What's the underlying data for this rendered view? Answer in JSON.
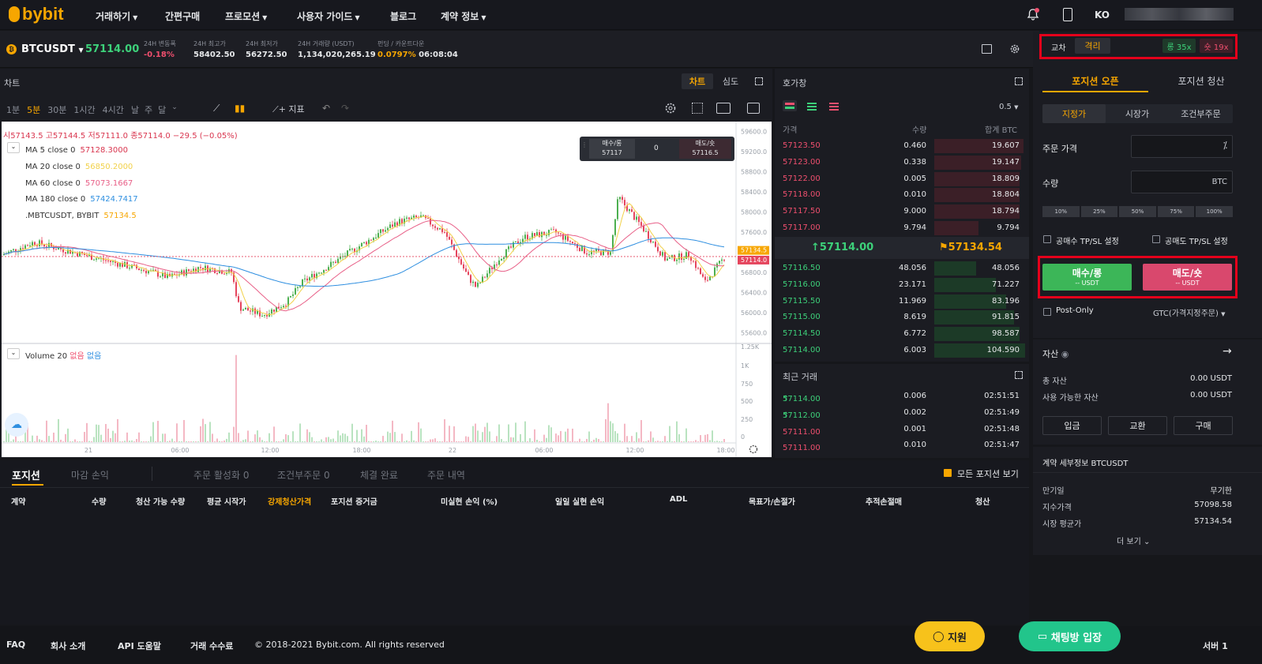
{
  "nav": {
    "logo": "bybit",
    "items": [
      "거래하기",
      "간편구매",
      "프로모션",
      "사용자 가이드",
      "블로그",
      "계약 정보"
    ],
    "lang": "KO"
  },
  "ticker": {
    "symbol": "BTCUSDT",
    "last": "57114.00",
    "labels": [
      "24H 변동폭",
      "24H 최고가",
      "24H 최저가",
      "24H 거래량 (USDT)",
      "펀딩 / 카운트다운"
    ],
    "values": [
      "-0.18%",
      "58402.50",
      "56272.50",
      "1,134,020,265.19",
      "0.0797%",
      "06:08:04"
    ]
  },
  "chart": {
    "title": "차트",
    "tab_chart": "차트",
    "tab_depth": "심도",
    "intervals": [
      "1분",
      "5분",
      "30분",
      "1시간",
      "4시간",
      "날",
      "주",
      "달"
    ],
    "indicator_label": "지표",
    "ohlc": "시57143.5 고57144.5 저57111.0 종57114.0 −29.5 (−0.05%)",
    "ma": [
      {
        "label": "MA 5 close 0",
        "value": "57128.3000",
        "color": "#d9364f"
      },
      {
        "label": "MA 20 close 0",
        "value": "56850.2000",
        "color": "#f2d149"
      },
      {
        "label": "MA 60 close 0",
        "value": "57073.1667",
        "color": "#e85f87"
      },
      {
        "label": "MA 180 close 0",
        "value": "57424.7417",
        "color": "#2f8fe0"
      },
      {
        "label": ".MBTCUSDT, BYBIT",
        "value": "57134.5",
        "color": "#f7a600"
      }
    ],
    "trade_widget": {
      "buy": "매수/롱",
      "buy_price": "57117",
      "qty": "0",
      "sell": "매도/숏",
      "sell_price": "57116.5"
    },
    "price_ticks": [
      "59600.0",
      "59200.0",
      "58800.0",
      "58400.0",
      "58000.0",
      "57600.0",
      "57200.0",
      "56800.0",
      "56400.0",
      "56000.0",
      "55600.0"
    ],
    "last_badge": "57134.5",
    "last_badge2": "57114.0",
    "volume_label": "Volume 20",
    "vol_na1": "없음",
    "vol_na2": "없음",
    "vol_ticks": [
      "1.25K",
      "1K",
      "750",
      "500",
      "250",
      "0"
    ],
    "time_ticks": [
      "21",
      "06:00",
      "12:00",
      "18:00",
      "22",
      "06:00",
      "12:00",
      "18:00"
    ]
  },
  "orderbook": {
    "title": "호가창",
    "precision": "0.5",
    "cols": [
      "가격",
      "수량",
      "합계 BTC"
    ],
    "asks": [
      [
        "57123.50",
        "0.460",
        "19.607"
      ],
      [
        "57123.00",
        "0.338",
        "19.147"
      ],
      [
        "57122.00",
        "0.005",
        "18.809"
      ],
      [
        "57118.00",
        "0.010",
        "18.804"
      ],
      [
        "57117.50",
        "9.000",
        "18.794"
      ],
      [
        "57117.00",
        "9.794",
        "9.794"
      ]
    ],
    "mid_last": "57114.00",
    "mid_mark": "57134.54",
    "bids": [
      [
        "57116.50",
        "48.056",
        "48.056"
      ],
      [
        "57116.00",
        "23.171",
        "71.227"
      ],
      [
        "57115.50",
        "11.969",
        "83.196"
      ],
      [
        "57115.00",
        "8.619",
        "91.815"
      ],
      [
        "57114.50",
        "6.772",
        "98.587"
      ],
      [
        "57114.00",
        "6.003",
        "104.590"
      ]
    ]
  },
  "trades": {
    "title": "최근 거래",
    "rows": [
      [
        "57114.00",
        "0.006",
        "02:51:51",
        "up"
      ],
      [
        "57112.00",
        "0.002",
        "02:51:49",
        "up"
      ],
      [
        "57111.00",
        "0.001",
        "02:51:48",
        "down"
      ],
      [
        "57111.00",
        "0.010",
        "02:51:47",
        "down"
      ]
    ]
  },
  "positions": {
    "tabs": [
      "포지션",
      "마감 손익",
      "주문 활성화 0",
      "조건부주문 0",
      "체결 완료",
      "주문 내역"
    ],
    "show_all": "모든 포지션 보기",
    "cols": [
      "계약",
      "수량",
      "청산 가능 수량",
      "평균 시작가",
      "강제청산가격",
      "포지션 증거금",
      "미실현 손익 (%)",
      "일일 실현 손익",
      "ADL",
      "목표가/손절가",
      "추적손절매",
      "청산"
    ]
  },
  "order": {
    "cross": "교차",
    "isolated": "격리",
    "long_lev": "롱 35x",
    "short_lev": "숏 19x",
    "tab_open": "포지션 오픈",
    "tab_close": "포지션 청산",
    "types": [
      "지정가",
      "시장가",
      "조건부주문"
    ],
    "price_label": "주문 가격",
    "qty_label": "수량",
    "qty_unit": "BTC",
    "pcts": [
      "10%",
      "25%",
      "50%",
      "75%",
      "100%"
    ],
    "tpsl_long": "공매수 TP/SL 설정",
    "tpsl_short": "공매도 TP/SL 설정",
    "buy": "매수/롱",
    "buy_sub": "-- USDT",
    "sell": "매도/숏",
    "sell_sub": "-- USDT",
    "post_only": "Post-Only",
    "tif": "GTC(가격지정주문)"
  },
  "assets": {
    "title": "자산",
    "total_label": "총 자산",
    "total": "0.00 USDT",
    "avail_label": "사용 가능한 자산",
    "avail": "0.00 USDT",
    "btns": [
      "입금",
      "교환",
      "구매"
    ]
  },
  "contract": {
    "title": "계약 세부정보 BTCUSDT",
    "rows": [
      [
        "만기일",
        "무기한"
      ],
      [
        "지수가격",
        "57098.58"
      ],
      [
        "시장 평균가",
        "57134.54"
      ]
    ],
    "more": "더 보기"
  },
  "footer": {
    "links": [
      "FAQ",
      "회사 소개",
      "API 도움말",
      "거래 수수료"
    ],
    "copyright": "© 2018-2021 Bybit.com. All rights reserved",
    "support": "지원",
    "chat": "채팅방 입장",
    "server": "서버 1"
  },
  "colors": {
    "bg": "#16171b",
    "panel": "#1b1c22",
    "accent": "#f7a600",
    "buy": "#3dd17a",
    "sell": "#ef4f6e"
  }
}
